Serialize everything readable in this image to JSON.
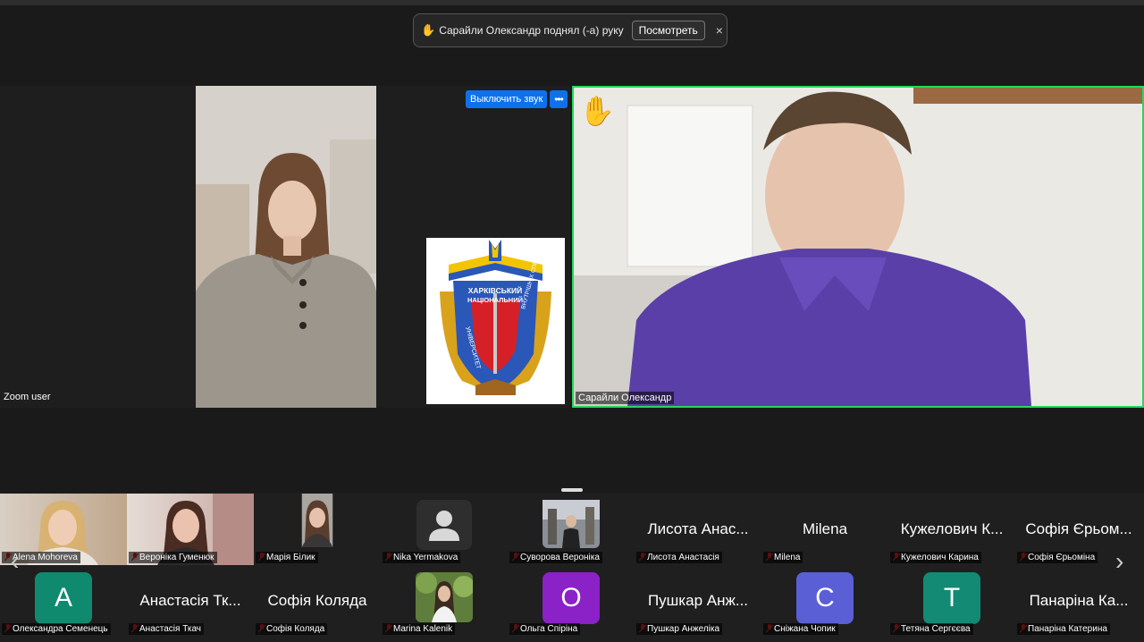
{
  "notification": {
    "hand_glyph": "✋",
    "message": "Сарайли Олександр поднял (-а) руку",
    "view_label": "Посмотреть",
    "close_glyph": "×"
  },
  "left_panel": {
    "unmute_label": "Выключить звук",
    "more_label": "•••",
    "participant_name": "Zoom user"
  },
  "logo": {
    "text_top": "ХАРКІВСЬКИЙ",
    "text_mid": "НАЦІОНАЛЬНИЙ",
    "text_left": "УНІВЕРСИТЕТ",
    "text_right": "ВНУТРІШНІХ СПРАВ"
  },
  "right_panel": {
    "participant_name": "Сарайли Олександр",
    "raised_hand_glyph": "✋"
  },
  "gallery": {
    "row1": [
      {
        "name": "Alena Mohoreva",
        "kind": "video"
      },
      {
        "name": "Вероніка Гуменюк",
        "kind": "video"
      },
      {
        "name": "Марія Білик",
        "kind": "video"
      },
      {
        "name": "Nika Yermakova",
        "kind": "avatar-icon"
      },
      {
        "name": "Суворова Вероніка",
        "kind": "photo"
      },
      {
        "name": "Лисота Анастасія",
        "big": "Лисота Анас...",
        "kind": "text"
      },
      {
        "name": "Milena",
        "big": "Milena",
        "kind": "text"
      },
      {
        "name": "Кужелович Карина",
        "big": "Кужелович К...",
        "kind": "text"
      },
      {
        "name": "Софія Єрьоміна",
        "big": "Софія Єрьом...",
        "kind": "text"
      }
    ],
    "row2": [
      {
        "name": "Олександра Семенець",
        "letter": "A",
        "color": "#0f8a6f",
        "kind": "letter"
      },
      {
        "name": "Анастасія Ткач",
        "big": "Анастасія Тк...",
        "kind": "text"
      },
      {
        "name": "Софія Коляда",
        "big": "Софія Коляда",
        "kind": "text"
      },
      {
        "name": "Marina Kalenik",
        "kind": "photo"
      },
      {
        "name": "Ольга Спіріна",
        "letter": "O",
        "color": "#8a22c8",
        "kind": "letter"
      },
      {
        "name": "Пушкар Анжеліка",
        "big": "Пушкар Анж...",
        "kind": "text"
      },
      {
        "name": "Сніжана Чопик",
        "letter": "C",
        "color": "#5a5fd6",
        "kind": "letter"
      },
      {
        "name": "Тетяна Сергєєва",
        "letter": "T",
        "color": "#138a73",
        "kind": "letter"
      },
      {
        "name": "Панаріна Катерина",
        "big": "Панаріна Ка...",
        "kind": "text"
      }
    ],
    "prev_glyph": "‹",
    "next_glyph": "›"
  },
  "colors": {
    "speaker_border": "#23d959",
    "button_blue": "#0e71eb",
    "muted_red": "#e02828"
  }
}
